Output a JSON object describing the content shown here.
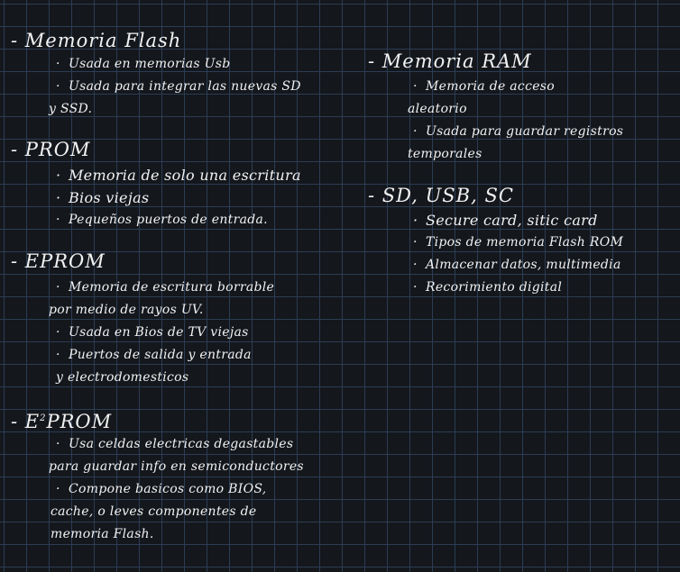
{
  "left": {
    "flash": {
      "heading": "- Memoria Flash",
      "l1": "Usada en memorias Usb",
      "l2": "Usada para integrar las nuevas SD",
      "l3": "y SSD."
    },
    "prom": {
      "heading": "- PROM",
      "l1": "Memoria de solo una escritura",
      "l2": "Bios viejas",
      "l3": "Pequeños puertos de entrada."
    },
    "eprom": {
      "heading": "- EPROM",
      "l1": "Memoria de escritura borrable",
      "l2": "por medio de rayos UV.",
      "l3": "Usada en Bios de TV viejas",
      "l4": "Puertos de salida y entrada",
      "l5": "y electrodomesticos"
    },
    "e2prom": {
      "heading_prefix": "- E",
      "sup": "2",
      "heading_suffix": "PROM",
      "l1": "Usa celdas electricas degastables",
      "l2": "para guardar info en semiconductores",
      "l3": "Compone basicos como BIOS,",
      "l4": "cache, o leves componentes de",
      "l5": "memoria Flash."
    }
  },
  "right": {
    "ram": {
      "heading": "- Memoria RAM",
      "l1": "Memoria de acceso",
      "l2": "aleatorio",
      "l3": "Usada para guardar registros",
      "l4": "temporales"
    },
    "sd": {
      "heading": "- SD, USB, SC",
      "l1": "Secure card, sitic card",
      "l2": "Tipos de memoria Flash ROM",
      "l3": "Almacenar datos, multimedia",
      "l4": "Recorimiento digital"
    }
  },
  "bullet_symbol": "·"
}
